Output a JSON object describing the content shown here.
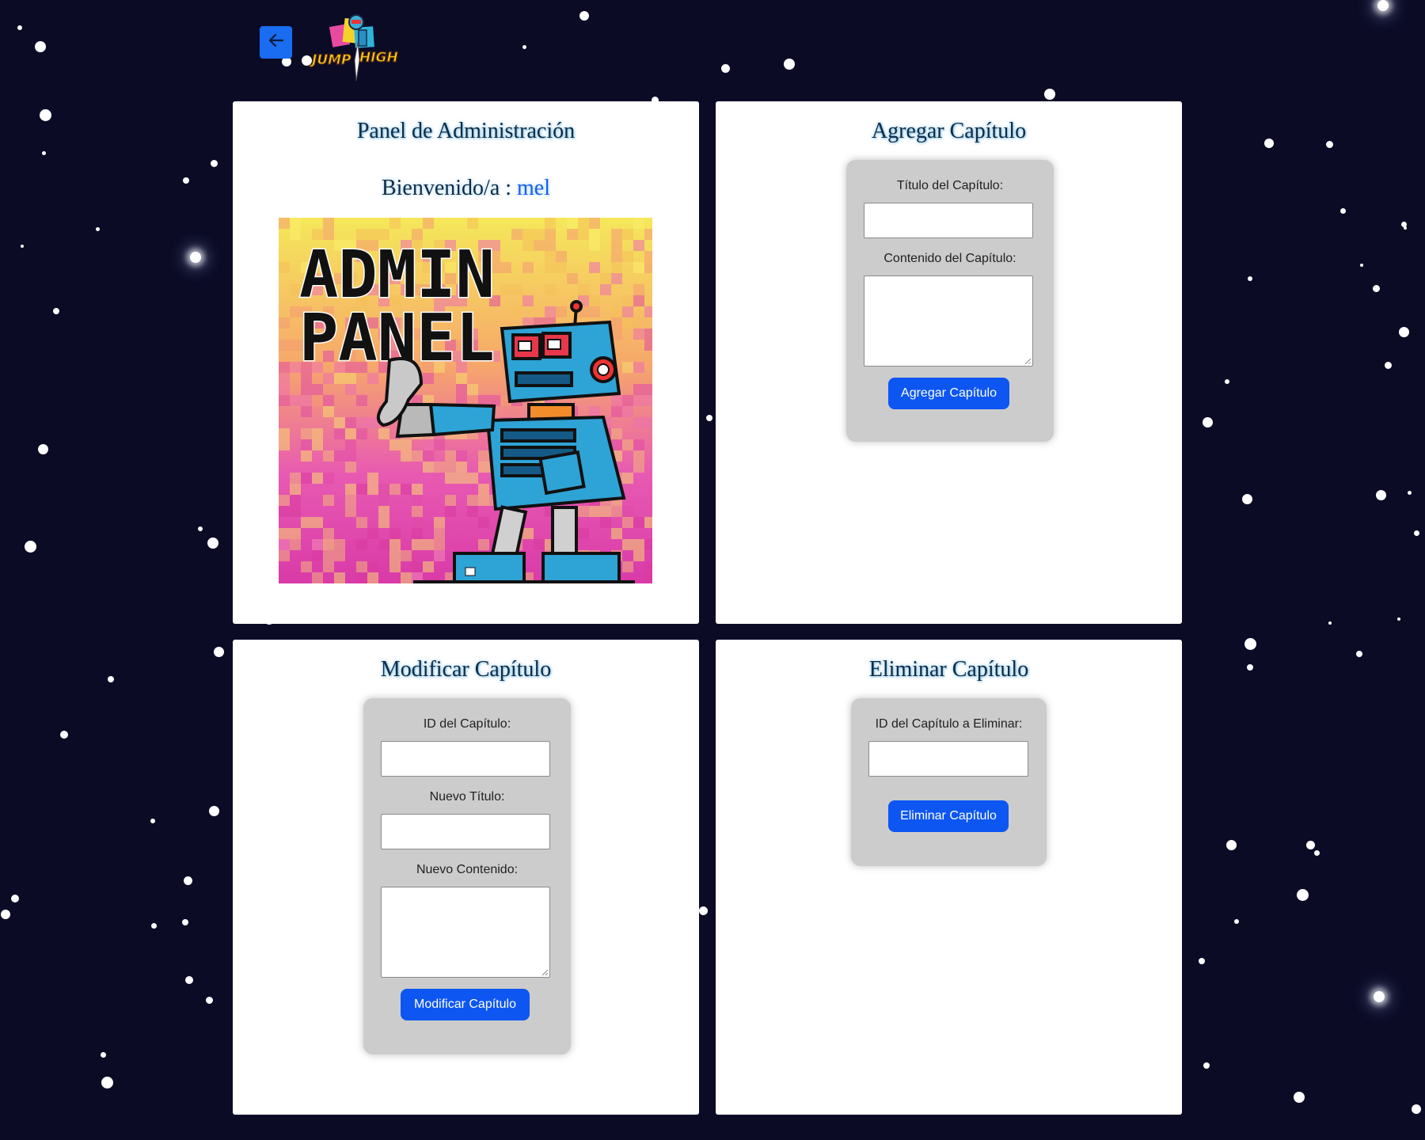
{
  "nav": {
    "back_icon": "arrow-left-icon",
    "logo_text": [
      "JUMP",
      "HIGH"
    ]
  },
  "admin_panel": {
    "title": "Panel de Administración",
    "welcome_label": "Bienvenido/a :",
    "username": "mel",
    "image_text": [
      "ADMIN",
      "PANEL"
    ]
  },
  "add_chapter": {
    "title": "Agregar Capítulo",
    "title_label": "Título del Capítulo:",
    "title_value": "",
    "content_label": "Contenido del Capítulo:",
    "content_value": "",
    "button_label": "Agregar Capítulo"
  },
  "modify_chapter": {
    "title": "Modificar Capítulo",
    "id_label": "ID del Capítulo:",
    "id_value": "",
    "new_title_label": "Nuevo Título:",
    "new_title_value": "",
    "new_content_label": "Nuevo Contenido:",
    "new_content_value": "",
    "button_label": "Modificar Capítulo"
  },
  "delete_chapter": {
    "title": "Eliminar Capítulo",
    "id_label": "ID del Capítulo a Eliminar:",
    "id_value": "",
    "button_label": "Eliminar Capítulo"
  },
  "colors": {
    "background": "#0b0b26",
    "accent": "#0d56f2",
    "heading": "#0f2c48",
    "username": "#1660ee",
    "form_box": "#cccccc"
  }
}
